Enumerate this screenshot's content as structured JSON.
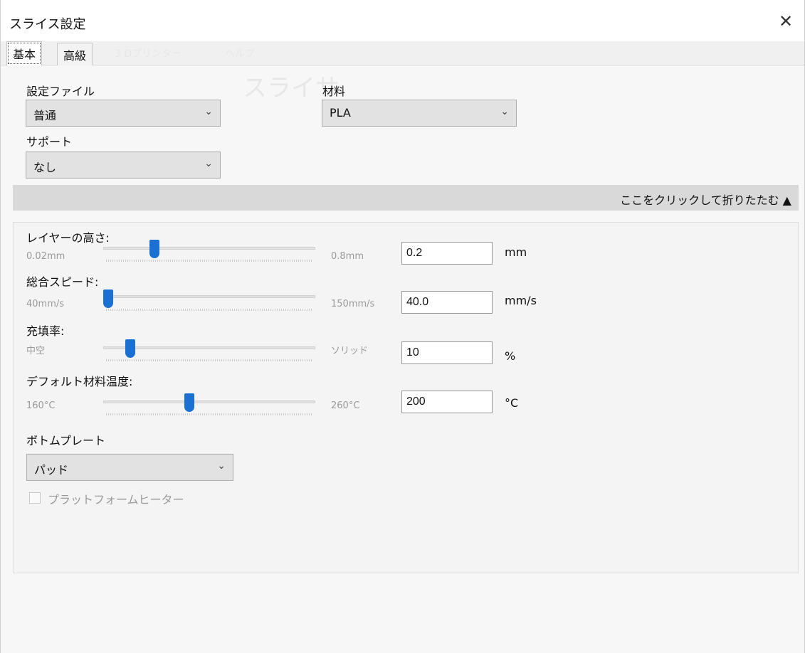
{
  "window": {
    "title": "スライス設定",
    "close_icon": "✕"
  },
  "tabs": [
    {
      "label": "基本",
      "active": true
    },
    {
      "label": "高級",
      "active": false
    }
  ],
  "ghost_menu": {
    "item1": "3 Dプリンター",
    "item2": "ヘルプ",
    "slicer_label": "スライサ"
  },
  "settings_file": {
    "label": "設定ファイル",
    "value": "普通"
  },
  "material": {
    "label": "材料",
    "value": "PLA"
  },
  "support": {
    "label": "サポート",
    "value": "なし"
  },
  "collapse": {
    "text": "ここをクリックして折りたたむ ▲"
  },
  "sliders": [
    {
      "label": "レイヤーの高さ:",
      "min": "0.02mm",
      "max": "0.8mm",
      "value": "0.2",
      "unit": "mm",
      "position": 0.23
    },
    {
      "label": "総合スピード:",
      "min": "40mm/s",
      "max": "150mm/s",
      "value": "40.0",
      "unit": "mm/s",
      "position": 0.0
    },
    {
      "label": "充填率:",
      "min": "中空",
      "max": "ソリッド",
      "value": "10",
      "unit": "%",
      "position": 0.11
    },
    {
      "label": "デフォルト材料温度:",
      "min": "160°C",
      "max": "260°C",
      "value": "200",
      "unit": "°C",
      "position": 0.4
    }
  ],
  "bottom_plate": {
    "label": "ボトムプレート",
    "value": "パッド"
  },
  "platform_heater": {
    "label": "プラットフォームヒーター",
    "checked": false
  },
  "colors": {
    "accent": "#1b70d3",
    "collapse_bar": "#d9d9d9"
  }
}
